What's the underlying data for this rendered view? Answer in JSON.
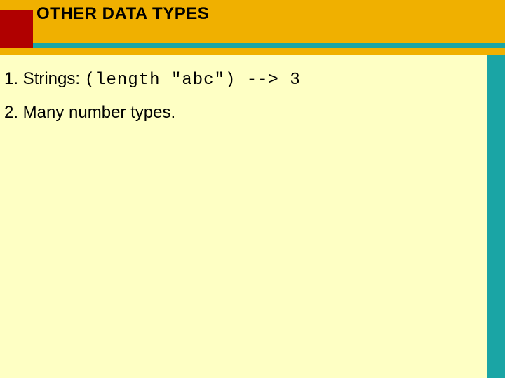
{
  "header": {
    "title": "OTHER DATA TYPES"
  },
  "content": {
    "line1": {
      "prefix": "1. Strings: ",
      "code": "(length \"abc\") --> 3"
    },
    "line2": {
      "text": "2. Many number types."
    }
  }
}
